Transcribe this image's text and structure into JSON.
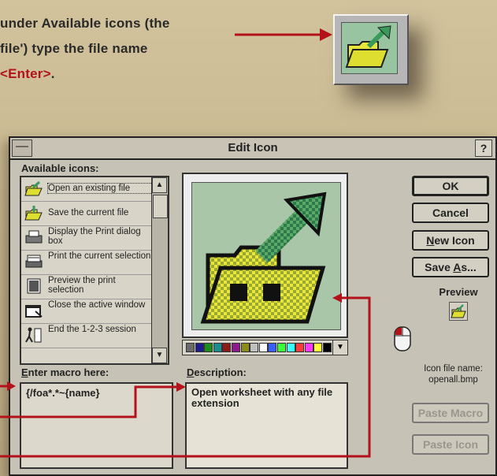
{
  "instructions": {
    "line1": "under Available icons (the",
    "line2": "file') type the file name",
    "line3_prefix": "",
    "line3_key": "<Enter>",
    "line3_suffix": "."
  },
  "dialog": {
    "title": "Edit Icon",
    "sysmenu_glyph": "—",
    "help_label": "?",
    "available_label_pre": "Available icons",
    "available_label_post": ":",
    "icons": [
      {
        "label": "Open an existing file",
        "icon": "open-folder-arrow-icon"
      },
      {
        "label": "Save the current file",
        "icon": "save-folder-arrow-icon"
      },
      {
        "label": "Display the Print dialog box",
        "icon": "printer-icon"
      },
      {
        "label": "Print the current selection",
        "icon": "print-selection-icon"
      },
      {
        "label": "Preview the print selection",
        "icon": "print-preview-icon"
      },
      {
        "label": "Close the active window",
        "icon": "close-window-icon"
      },
      {
        "label": "End the 1-2-3 session",
        "icon": "exit-runner-icon"
      }
    ],
    "scroll_up": "▲",
    "scroll_down": "▼",
    "macro_label_u": "E",
    "macro_label_rest": "nter macro here:",
    "macro_value": "{/foa*.*~{name}",
    "desc_label_u": "D",
    "desc_label_rest": "escription:",
    "desc_value": "Open worksheet with any file extension",
    "palette_colors": [
      "#6b6b6b",
      "#1c1c8c",
      "#1c8c1c",
      "#1c8c8c",
      "#8c1c1c",
      "#8c1c8c",
      "#8c8c1c",
      "#c0c0c0",
      "#ffffff",
      "#3a5fff",
      "#3aff3a",
      "#3affff",
      "#ff3a3a",
      "#ff3aff",
      "#ffff3a",
      "#000000"
    ],
    "palette_arrow": "▼",
    "buttons": {
      "ok": "OK",
      "cancel": "Cancel",
      "new_icon_u": "N",
      "new_icon_rest": "ew Icon",
      "save_as_pre": "Save ",
      "save_as_u": "A",
      "save_as_rest": "s...",
      "paste_macro": "Paste Macro",
      "paste_icon": "Paste Icon"
    },
    "preview_label": "Preview",
    "icon_file_label": "Icon file name:",
    "icon_file_value": "openall.bmp"
  },
  "colors": {
    "callout": "#b3121a",
    "folder_yellow": "#e8e63c",
    "arrow_green": "#3a9a5a"
  }
}
